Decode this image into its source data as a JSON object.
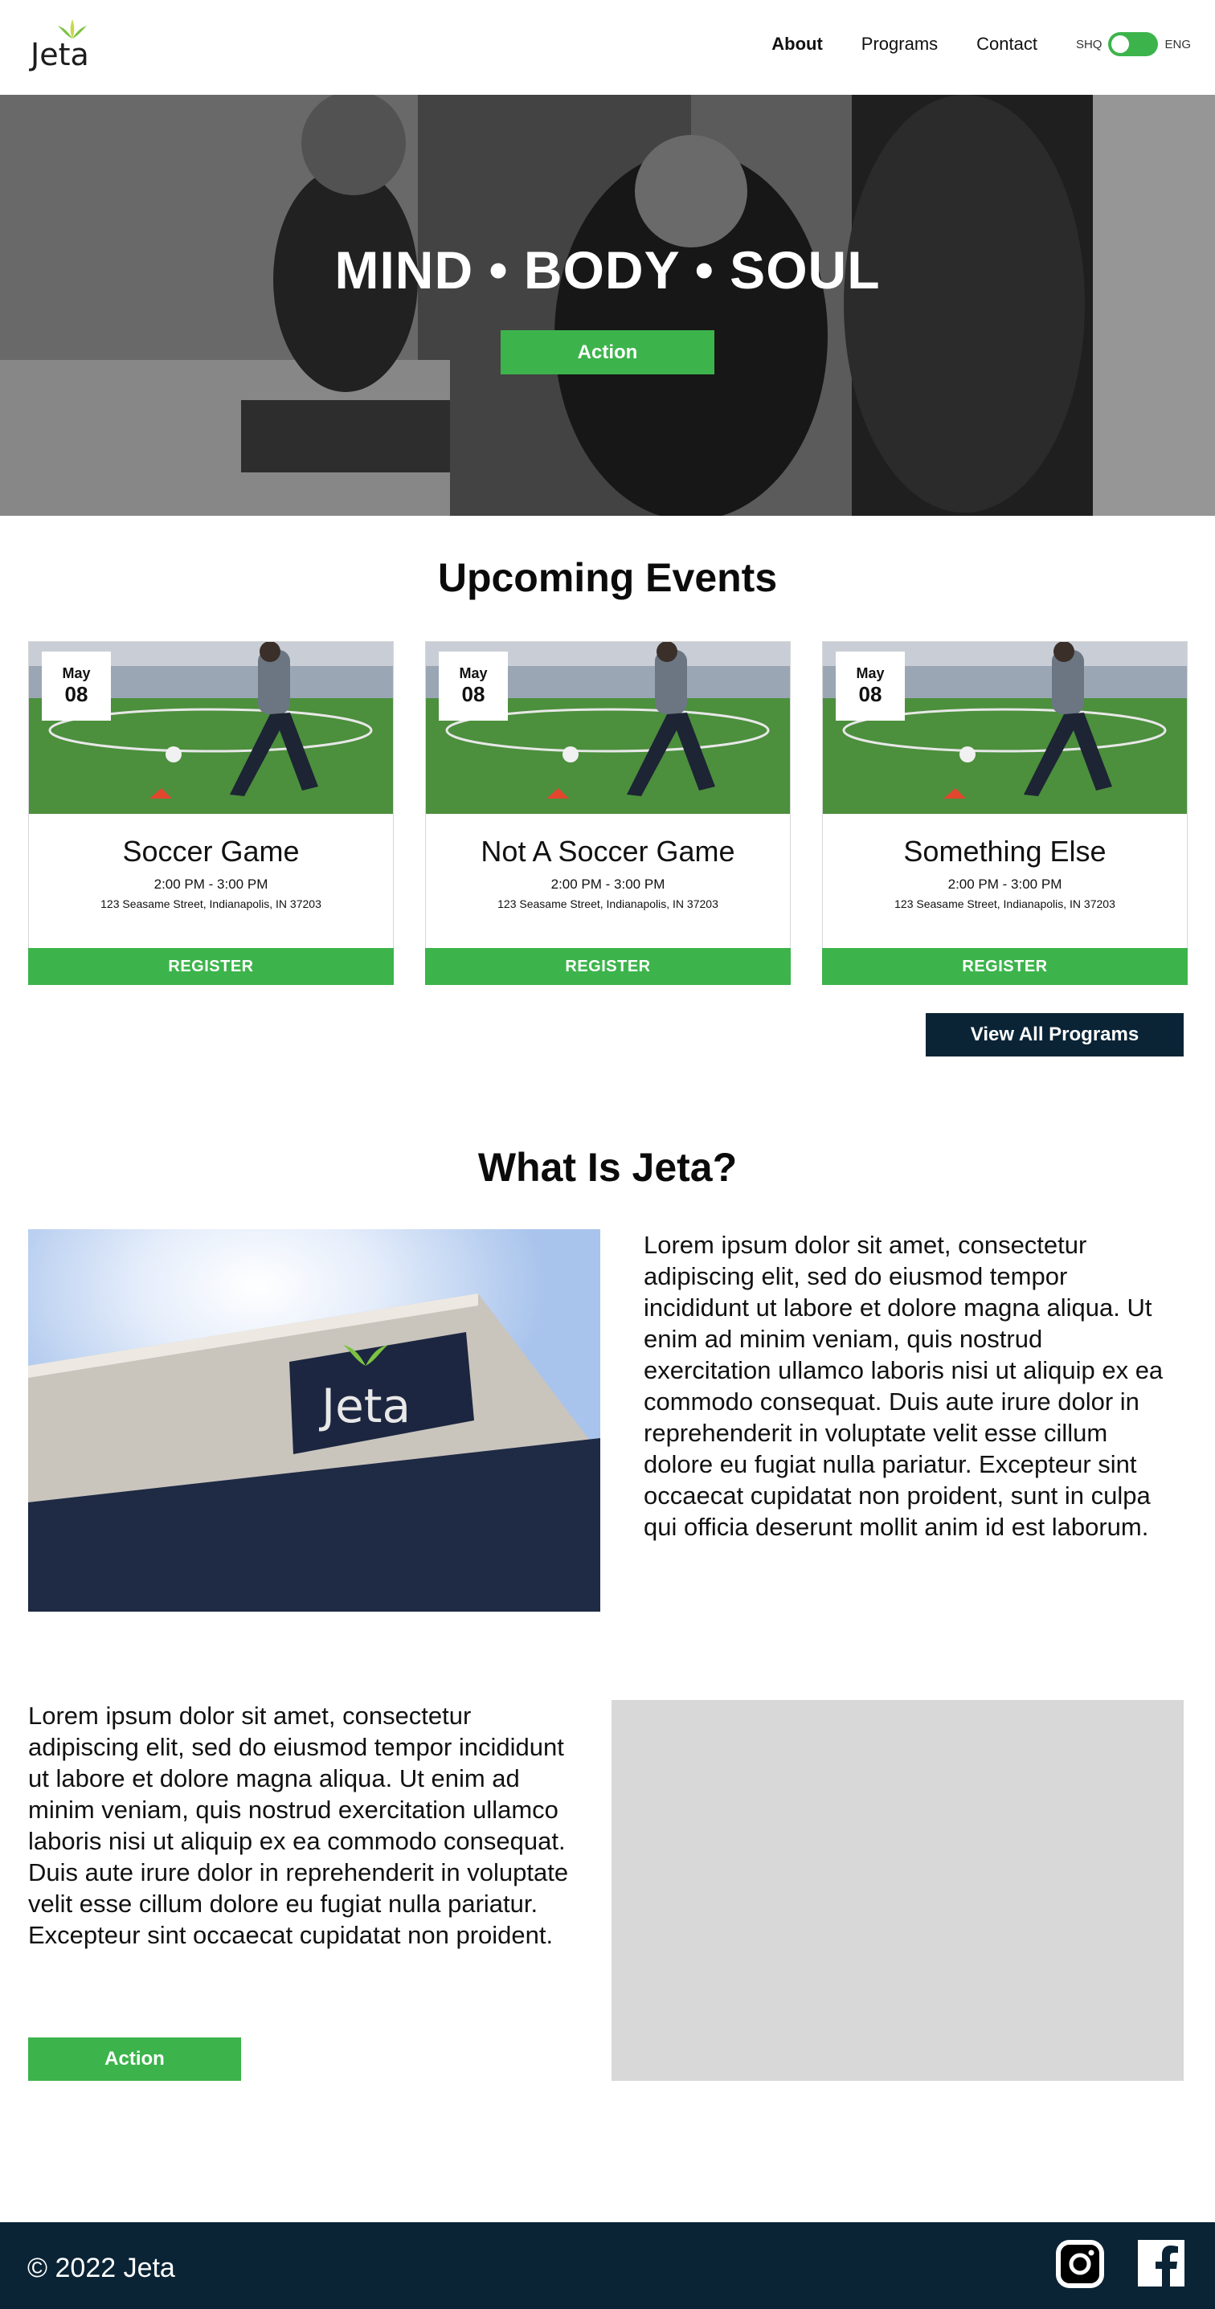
{
  "header": {
    "logo_text": "Jeta",
    "nav": [
      {
        "label": "About",
        "active": true
      },
      {
        "label": "Programs",
        "active": false
      },
      {
        "label": "Contact",
        "active": false
      }
    ],
    "lang_left": "SHQ",
    "lang_right": "ENG"
  },
  "hero": {
    "title": "MIND • BODY • SOUL",
    "button": "Action"
  },
  "events": {
    "title": "Upcoming Events",
    "items": [
      {
        "month": "May",
        "day": "08",
        "title": "Soccer Game",
        "time": "2:00 PM - 3:00 PM",
        "address": "123 Seasame Street, Indianapolis, IN 37203",
        "button": "REGISTER"
      },
      {
        "month": "May",
        "day": "08",
        "title": "Not A Soccer Game",
        "time": "2:00 PM - 3:00 PM",
        "address": "123 Seasame Street, Indianapolis, IN 37203",
        "button": "REGISTER"
      },
      {
        "month": "May",
        "day": "08",
        "title": "Something Else",
        "time": "2:00 PM - 3:00 PM",
        "address": "123 Seasame Street, Indianapolis, IN 37203",
        "button": "REGISTER"
      }
    ],
    "view_all": "View All Programs"
  },
  "about": {
    "title": "What Is Jeta?",
    "sign_text": "Jeta",
    "paragraph1": "Lorem ipsum dolor sit amet, consectetur adipiscing elit, sed do eiusmod tempor incididunt ut labore et dolore magna aliqua. Ut enim ad minim veniam, quis nostrud exercitation ullamco laboris nisi ut aliquip ex ea commodo consequat. Duis aute irure dolor in reprehenderit in voluptate velit esse cillum dolore eu fugiat nulla pariatur. Excepteur sint occaecat cupidatat non proident, sunt in culpa qui officia deserunt mollit anim id est laborum.",
    "paragraph2": "Lorem ipsum dolor sit amet, consectetur adipiscing elit, sed do eiusmod tempor incididunt ut labore et dolore magna aliqua. Ut enim ad minim veniam, quis nostrud exercitation ullamco laboris nisi ut aliquip ex ea commodo consequat. Duis aute irure dolor in reprehenderit in voluptate velit esse cillum dolore eu fugiat nulla pariatur. Excepteur sint occaecat cupidatat non proident.",
    "button": "Action"
  },
  "footer": {
    "copyright": "© 2022 Jeta",
    "icons": [
      "instagram-icon",
      "facebook-icon"
    ]
  },
  "colors": {
    "brand_green": "#3cb44b",
    "navy": "#0a2436",
    "placeholder_gray": "#d8d8d8"
  }
}
